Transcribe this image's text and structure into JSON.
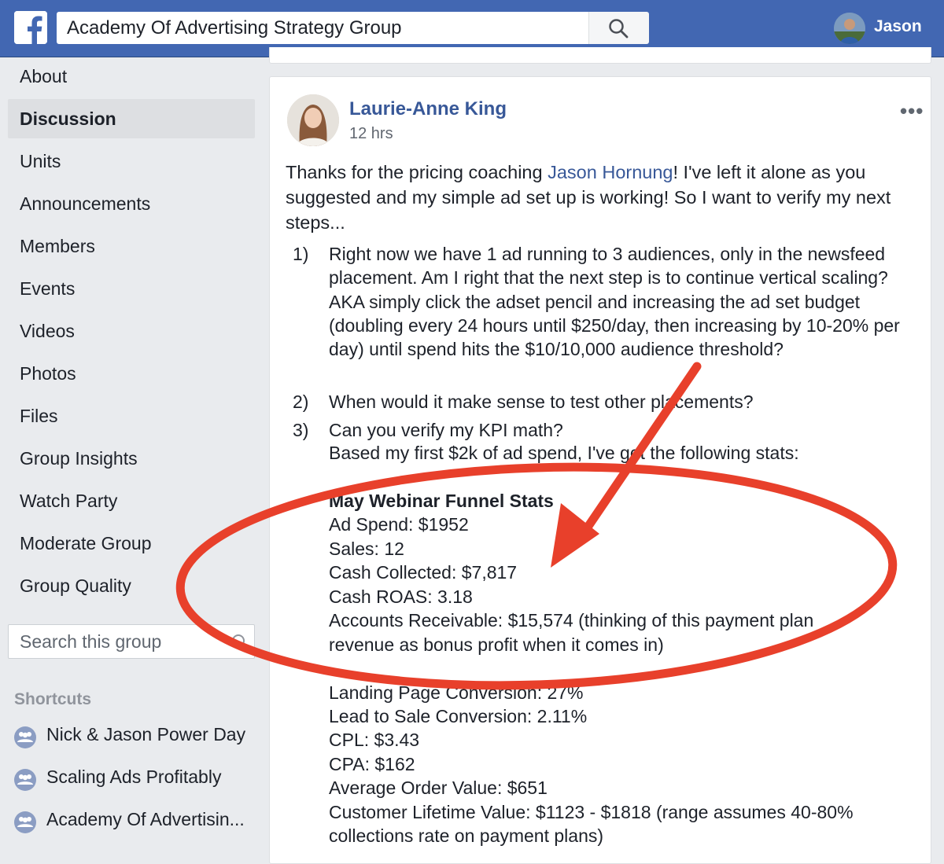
{
  "topbar": {
    "search_value": "Academy Of Advertising Strategy Group",
    "user_name": "Jason",
    "colors": {
      "bar": "#4267b2",
      "link": "#385898"
    }
  },
  "sidebar": {
    "items": [
      {
        "label": "About"
      },
      {
        "label": "Discussion"
      },
      {
        "label": "Units"
      },
      {
        "label": "Announcements"
      },
      {
        "label": "Members"
      },
      {
        "label": "Events"
      },
      {
        "label": "Videos"
      },
      {
        "label": "Photos"
      },
      {
        "label": "Files"
      },
      {
        "label": "Group Insights"
      },
      {
        "label": "Watch Party"
      },
      {
        "label": "Moderate Group"
      },
      {
        "label": "Group Quality"
      }
    ],
    "active_item": "Discussion",
    "search_placeholder": "Search this group",
    "shortcuts_title": "Shortcuts",
    "shortcuts": [
      {
        "label": "Nick & Jason Power Day"
      },
      {
        "label": "Scaling Ads Profitably"
      },
      {
        "label": "Academy Of Advertisin..."
      }
    ]
  },
  "post": {
    "author": "Laurie-Anne King",
    "time": "12 hrs",
    "intro_before": "Thanks for the pricing coaching ",
    "intro_mention": "Jason Hornung",
    "intro_after": "! I've left it alone as you suggested and my simple ad set up is working! So I want to verify my next steps...",
    "list": [
      {
        "num": "1)",
        "text": "Right now we have 1 ad running to 3 audiences, only in the newsfeed placement. Am I right that the next step is to continue vertical scaling? AKA simply click the adset pencil and increasing the ad set budget (doubling every 24 hours until $250/day, then increasing by 10-20% per day) until spend hits the $10/10,000 audience threshold?"
      },
      {
        "num": "2)",
        "text": "When would it make sense to test other placements?"
      },
      {
        "num": "3)",
        "text": "Can you verify my KPI math?"
      }
    ],
    "stats_intro": "Based my first $2k of ad spend, I've got the following stats:",
    "stats_title": "May Webinar Funnel Stats",
    "stats": [
      "Ad Spend: $1952",
      "Sales: 12",
      "Cash Collected: $7,817",
      "Cash ROAS: 3.18",
      "Accounts Receivable: $15,574 (thinking of this payment plan",
      "revenue as bonus profit when it comes in)"
    ],
    "stats2": [
      "Landing Page Conversion: 27%",
      "Lead to Sale Conversion: 2.11%",
      "CPL: $3.43",
      "CPA: $162",
      "Average Order Value: $651",
      "Customer Lifetime Value: $1123 - $1818 (range assumes 40-80%",
      "collections rate on payment plans)"
    ]
  },
  "annotation": {
    "color": "#e8402b"
  }
}
